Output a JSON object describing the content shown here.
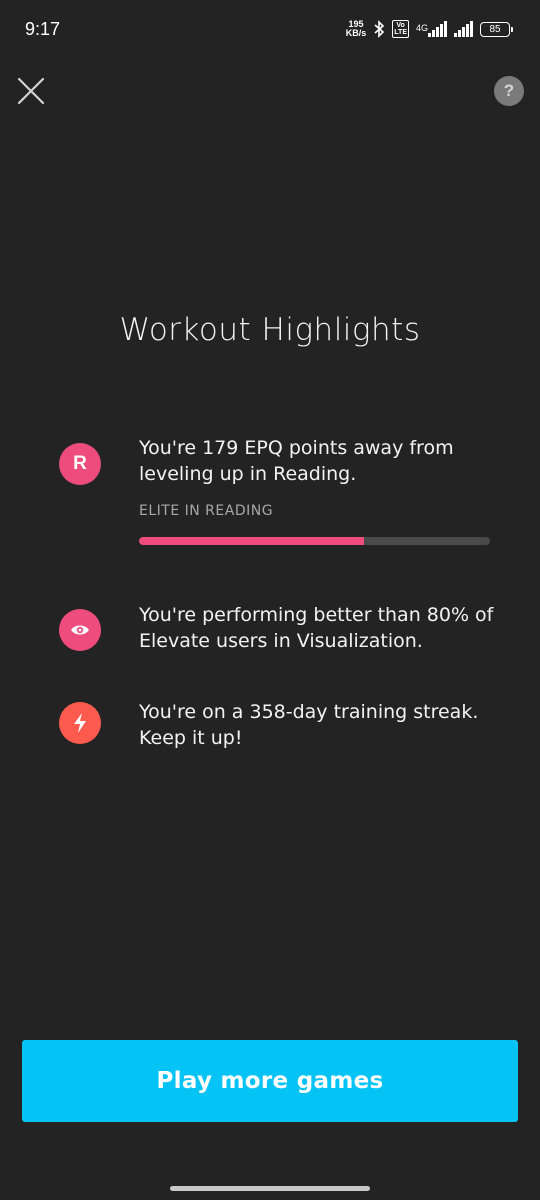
{
  "status_bar": {
    "time": "9:17",
    "net_speed_value": "195",
    "net_speed_unit": "KB/s",
    "volte_label_top": "Vo",
    "volte_label_bottom": "LTE",
    "network_type": "4G",
    "battery_level": "85"
  },
  "header": {
    "close_icon": "close-icon",
    "help_label": "?"
  },
  "title": "Workout Highlights",
  "highlights": [
    {
      "icon": "reading-letter-icon",
      "icon_letter": "R",
      "icon_color": "#ee4c7d",
      "text": "You're 179 EPQ points away from leveling up in Reading.",
      "level_label": "ELITE IN READING",
      "progress": 0.64
    },
    {
      "icon": "eye-icon",
      "icon_color": "#ee4c7d",
      "text": "You're performing better than 80% of Elevate users in Visualization."
    },
    {
      "icon": "lightning-bolt-icon",
      "icon_color": "#ff5a4e",
      "text": "You're on a 358-day training streak. Keep it up!"
    }
  ],
  "cta": {
    "label": "Play more games",
    "color": "#05c3f5"
  }
}
